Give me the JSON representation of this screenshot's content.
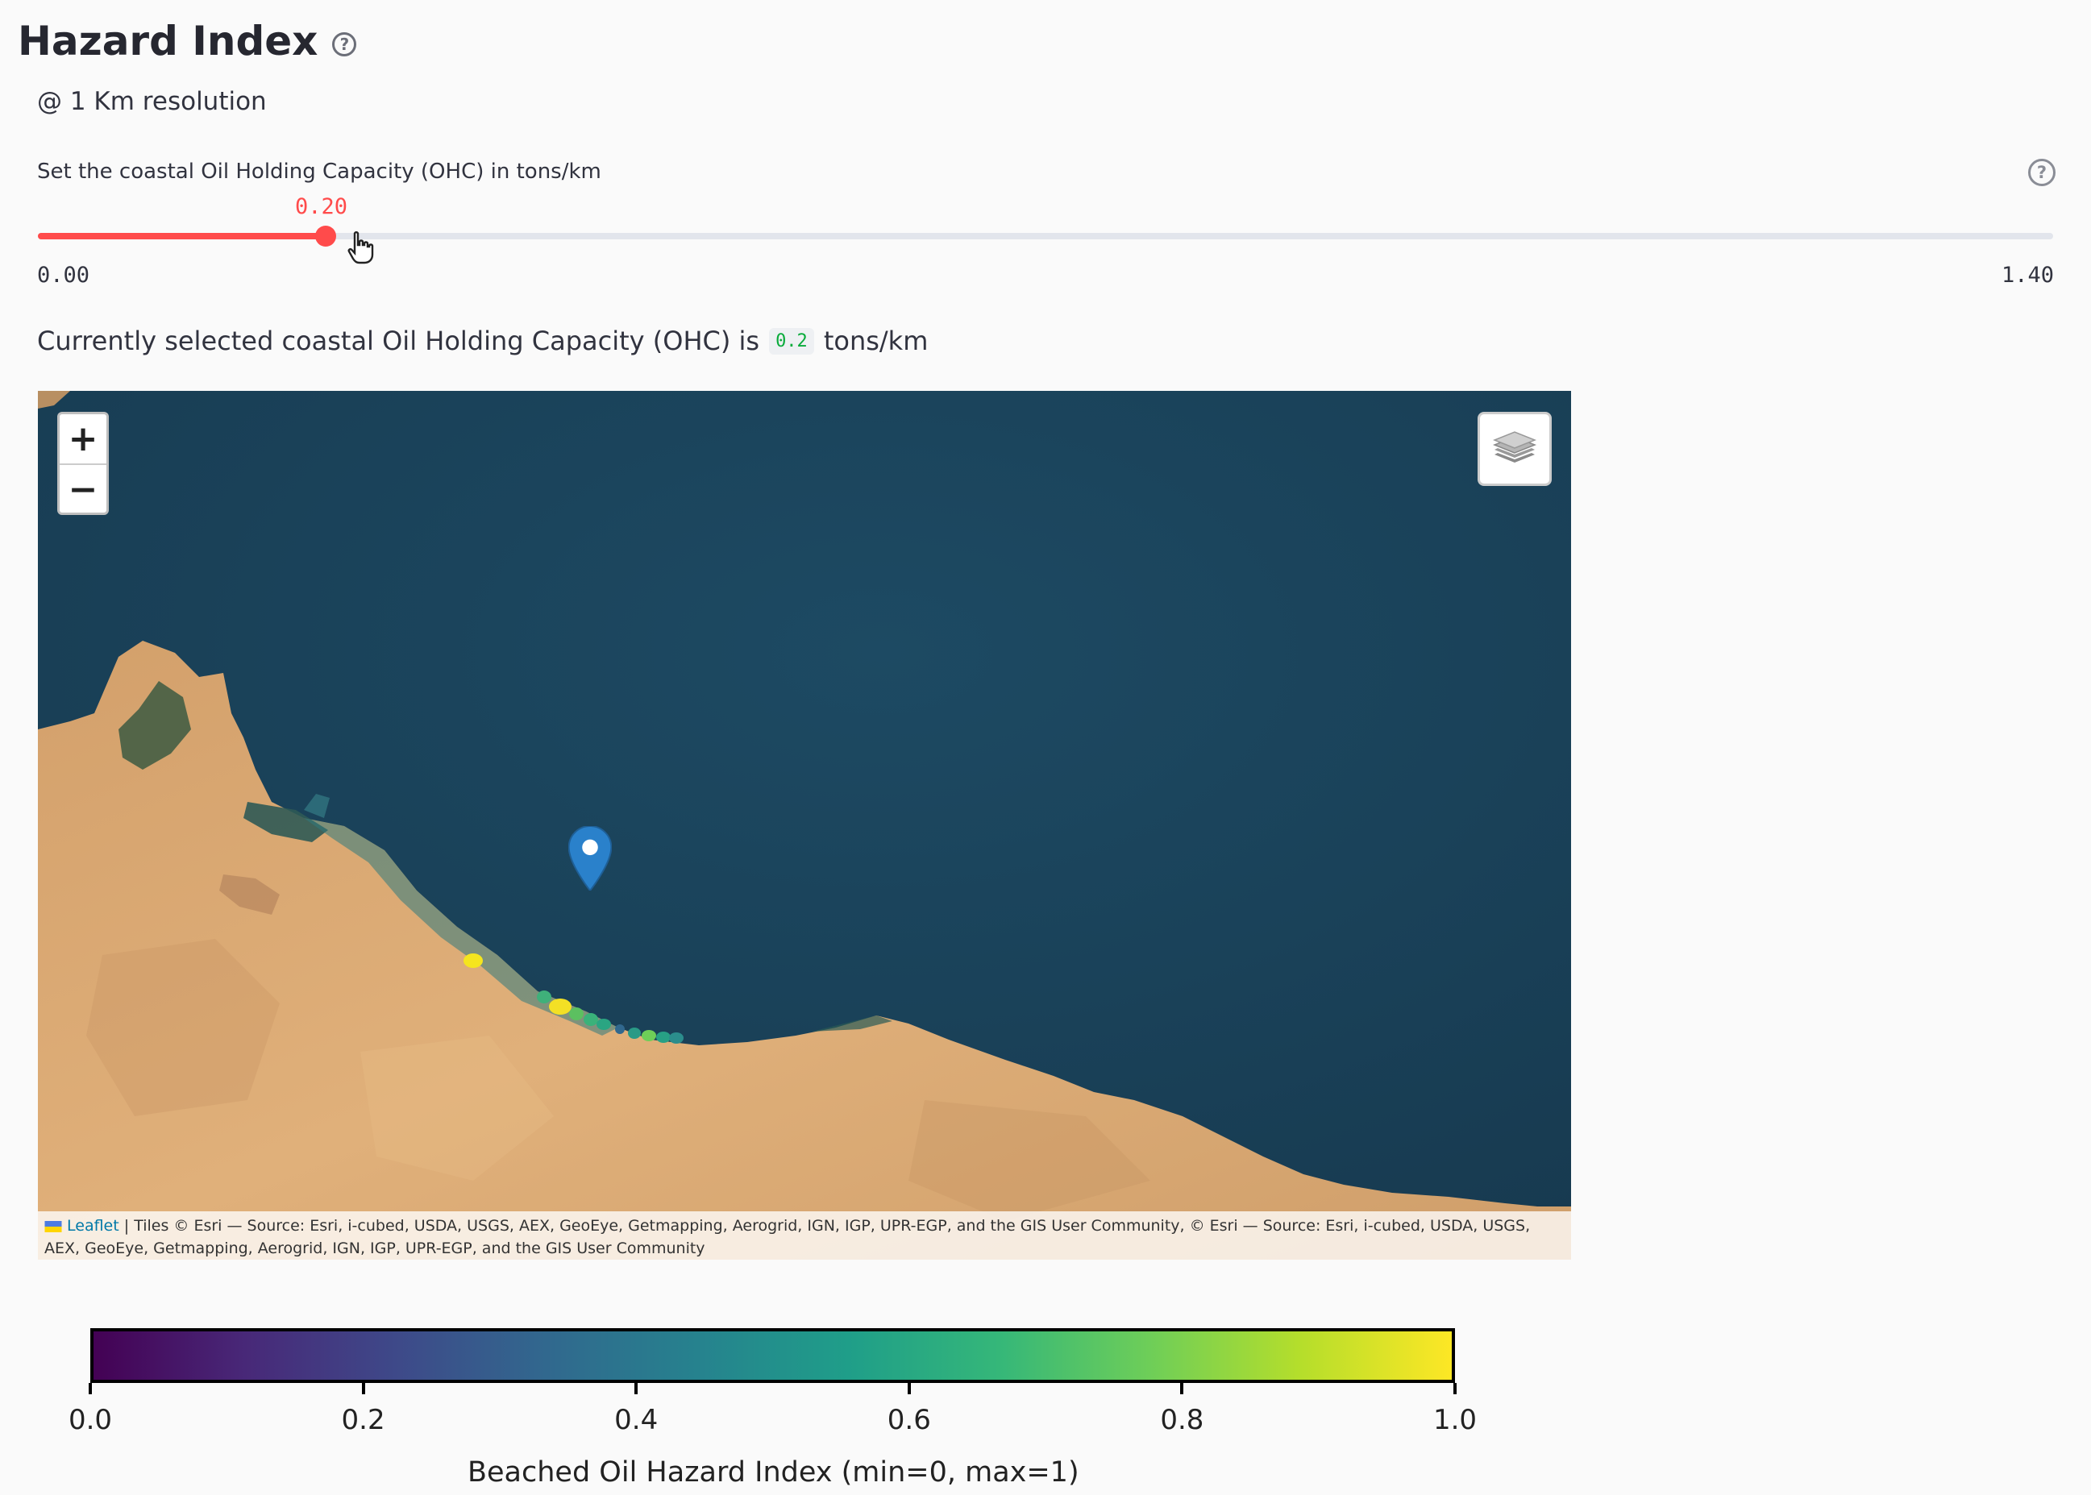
{
  "page": {
    "title": "Hazard Index",
    "help_glyph": "?",
    "subtitle": "@ 1 Km resolution"
  },
  "slider": {
    "label": "Set the coastal Oil Holding Capacity (OHC) in tons/km",
    "value_label": "0.20",
    "value": 0.2,
    "min_label": "0.00",
    "max_label": "1.40",
    "min": 0,
    "max": 1.4,
    "color": "#ff4b4b"
  },
  "current": {
    "prefix": "Currently selected coastal Oil Holding Capacity (OHC) is",
    "value": "0.2",
    "suffix": "tons/km"
  },
  "map": {
    "zoom_in": "+",
    "zoom_out": "−",
    "layers_icon": "layers-icon",
    "marker_icon": "map-marker-icon",
    "attribution_link": "Leaflet",
    "attribution_text": "| Tiles © Esri — Source: Esri, i-cubed, USDA, USGS, AEX, GeoEye, Getmapping, Aerogrid, IGN, IGP, UPR-EGP, and the GIS User Community, © Esri — Source: Esri, i-cubed, USDA, USGS, AEX, GeoEye, Getmapping, Aerogrid, IGN, IGP, UPR-EGP, and the GIS User Community",
    "sea_color": "#193e55",
    "land_color": "#d9a56f"
  },
  "colorbar": {
    "ticks": [
      "0.0",
      "0.2",
      "0.4",
      "0.6",
      "0.8",
      "1.0"
    ],
    "label": "Beached Oil Hazard Index (min=0, max=1)",
    "colormap": "viridis"
  }
}
